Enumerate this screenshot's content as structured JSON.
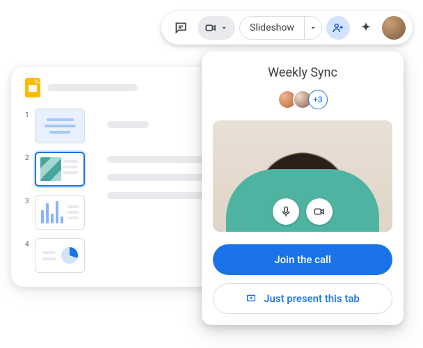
{
  "toolbar": {
    "slideshow_label": "Slideshow"
  },
  "editor": {
    "thumbnails": [
      {
        "number": "1"
      },
      {
        "number": "2"
      },
      {
        "number": "3"
      },
      {
        "number": "4"
      }
    ],
    "selected_index": 1
  },
  "meet": {
    "title": "Weekly Sync",
    "extra_participants": "+3",
    "join_label": "Join the call",
    "present_label": "Just present this tab"
  },
  "colors": {
    "primary": "#1a73e8",
    "slides_brand": "#ffba00"
  }
}
